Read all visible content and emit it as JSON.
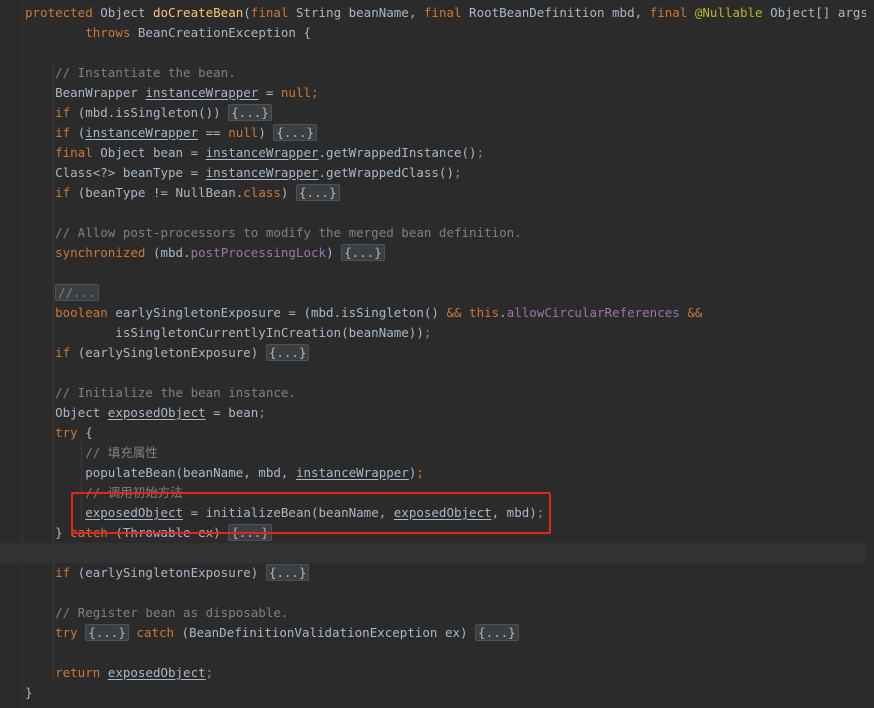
{
  "editor": {
    "colors": {
      "background": "#2b2b2b",
      "keyword": "#cc7832",
      "comment": "#808080",
      "method": "#ffc66d",
      "field": "#9876aa",
      "annotation": "#bbb529",
      "plain": "#a9b7c6",
      "highlight_box": "#e8231b"
    },
    "lines": [
      [
        {
          "text": "protected ",
          "cls": "kw"
        },
        {
          "text": "Object "
        },
        {
          "text": "doCreateBean",
          "cls": "fn"
        },
        {
          "text": "("
        },
        {
          "text": "final ",
          "cls": "kw"
        },
        {
          "text": "String beanName, "
        },
        {
          "text": "final ",
          "cls": "kw"
        },
        {
          "text": "RootBeanDefinition mbd, "
        },
        {
          "text": "final ",
          "cls": "kw"
        },
        {
          "text": "@Nullable ",
          "cls": "ann"
        },
        {
          "text": "Object[] args)"
        }
      ],
      [
        {
          "text": "        "
        },
        {
          "text": "throws ",
          "cls": "kw"
        },
        {
          "text": "BeanCreationException {"
        }
      ],
      [],
      [
        {
          "text": "    "
        },
        {
          "text": "// Instantiate the bean.",
          "cls": "cm"
        }
      ],
      [
        {
          "text": "    BeanWrapper "
        },
        {
          "text": "instanceWrapper",
          "cls": "ul"
        },
        {
          "text": " = "
        },
        {
          "text": "null",
          "cls": "kw"
        },
        {
          "text": ";",
          "cls": "kw"
        }
      ],
      [
        {
          "text": "    "
        },
        {
          "text": "if ",
          "cls": "kw"
        },
        {
          "text": "(mbd.isSingleton()) "
        },
        {
          "fold": "{...}"
        }
      ],
      [
        {
          "text": "    "
        },
        {
          "text": "if ",
          "cls": "kw"
        },
        {
          "text": "("
        },
        {
          "text": "instanceWrapper",
          "cls": "ul"
        },
        {
          "text": " == "
        },
        {
          "text": "null",
          "cls": "kw"
        },
        {
          "text": ") "
        },
        {
          "fold": "{...}"
        }
      ],
      [
        {
          "text": "    "
        },
        {
          "text": "final ",
          "cls": "kw"
        },
        {
          "text": "Object bean = "
        },
        {
          "text": "instanceWrapper",
          "cls": "ul"
        },
        {
          "text": ".getWrappedInstance()"
        },
        {
          "text": ";",
          "cls": "kw"
        }
      ],
      [
        {
          "text": "    Class<?> beanType = "
        },
        {
          "text": "instanceWrapper",
          "cls": "ul"
        },
        {
          "text": ".getWrappedClass()"
        },
        {
          "text": ";",
          "cls": "kw"
        }
      ],
      [
        {
          "text": "    "
        },
        {
          "text": "if ",
          "cls": "kw"
        },
        {
          "text": "(beanType != NullBean."
        },
        {
          "text": "class",
          "cls": "kw"
        },
        {
          "text": ") "
        },
        {
          "fold": "{...}"
        }
      ],
      [],
      [
        {
          "text": "    "
        },
        {
          "text": "// Allow post-processors to modify the merged bean definition.",
          "cls": "cm"
        }
      ],
      [
        {
          "text": "    "
        },
        {
          "text": "synchronized ",
          "cls": "kw"
        },
        {
          "text": "(mbd."
        },
        {
          "text": "postProcessingLock",
          "cls": "fld"
        },
        {
          "text": ") "
        },
        {
          "fold": "{...}"
        }
      ],
      [],
      [
        {
          "text": "    "
        },
        {
          "fold": "//...",
          "cls": "fold-cm"
        }
      ],
      [
        {
          "text": "    "
        },
        {
          "text": "boolean ",
          "cls": "kw"
        },
        {
          "text": "earlySingletonExposure = (mbd.isSingleton() "
        },
        {
          "text": "&& ",
          "cls": "kw"
        },
        {
          "text": "this",
          "cls": "kw"
        },
        {
          "text": "."
        },
        {
          "text": "allowCircularReferences ",
          "cls": "fld"
        },
        {
          "text": "&&",
          "cls": "kw"
        }
      ],
      [
        {
          "text": "            isSingletonCurrentlyInCreation(beanName))"
        },
        {
          "text": ";",
          "cls": "kw"
        }
      ],
      [
        {
          "text": "    "
        },
        {
          "text": "if ",
          "cls": "kw"
        },
        {
          "text": "(earlySingletonExposure) "
        },
        {
          "fold": "{...}"
        }
      ],
      [],
      [
        {
          "text": "    "
        },
        {
          "text": "// Initialize the bean instance.",
          "cls": "cm"
        }
      ],
      [
        {
          "text": "    Object "
        },
        {
          "text": "exposedObject",
          "cls": "ul"
        },
        {
          "text": " = bean"
        },
        {
          "text": ";",
          "cls": "kw"
        }
      ],
      [
        {
          "text": "    "
        },
        {
          "text": "try ",
          "cls": "kw"
        },
        {
          "text": "{"
        }
      ],
      [
        {
          "text": "        "
        },
        {
          "text": "// 填充属性",
          "cls": "cm"
        }
      ],
      [
        {
          "text": "        populateBean(beanName, mbd, "
        },
        {
          "text": "instanceWrapper",
          "cls": "ul"
        },
        {
          "text": ")"
        },
        {
          "text": ";",
          "cls": "kw"
        }
      ],
      [
        {
          "text": "        "
        },
        {
          "text": "// 调用初始方法",
          "cls": "cm"
        }
      ],
      [
        {
          "text": "        "
        },
        {
          "text": "exposedObject",
          "cls": "ul"
        },
        {
          "text": " = initializeBean(beanName, "
        },
        {
          "text": "exposedObject",
          "cls": "ul"
        },
        {
          "text": ", mbd)"
        },
        {
          "text": ";",
          "cls": "kw"
        }
      ],
      [
        {
          "text": "    } "
        },
        {
          "text": "catch ",
          "cls": "kw"
        },
        {
          "text": "(Throwable ex) "
        },
        {
          "fold": "{...}"
        }
      ],
      [],
      [
        {
          "text": "    "
        },
        {
          "text": "if ",
          "cls": "kw"
        },
        {
          "text": "(earlySingletonExposure) "
        },
        {
          "fold": "{...}"
        }
      ],
      [],
      [
        {
          "text": "    "
        },
        {
          "text": "// Register bean as disposable.",
          "cls": "cm"
        }
      ],
      [
        {
          "text": "    "
        },
        {
          "text": "try ",
          "cls": "kw"
        },
        {
          "fold": "{...}"
        },
        {
          "text": " "
        },
        {
          "text": "catch ",
          "cls": "kw"
        },
        {
          "text": "(BeanDefinitionValidationException ex) "
        },
        {
          "fold": "{...}"
        }
      ],
      [],
      [
        {
          "text": "    "
        },
        {
          "text": "return ",
          "cls": "kw"
        },
        {
          "text": "exposedObject",
          "cls": "ul"
        },
        {
          "text": ";",
          "cls": "kw"
        }
      ],
      [
        {
          "text": "}"
        }
      ]
    ]
  }
}
